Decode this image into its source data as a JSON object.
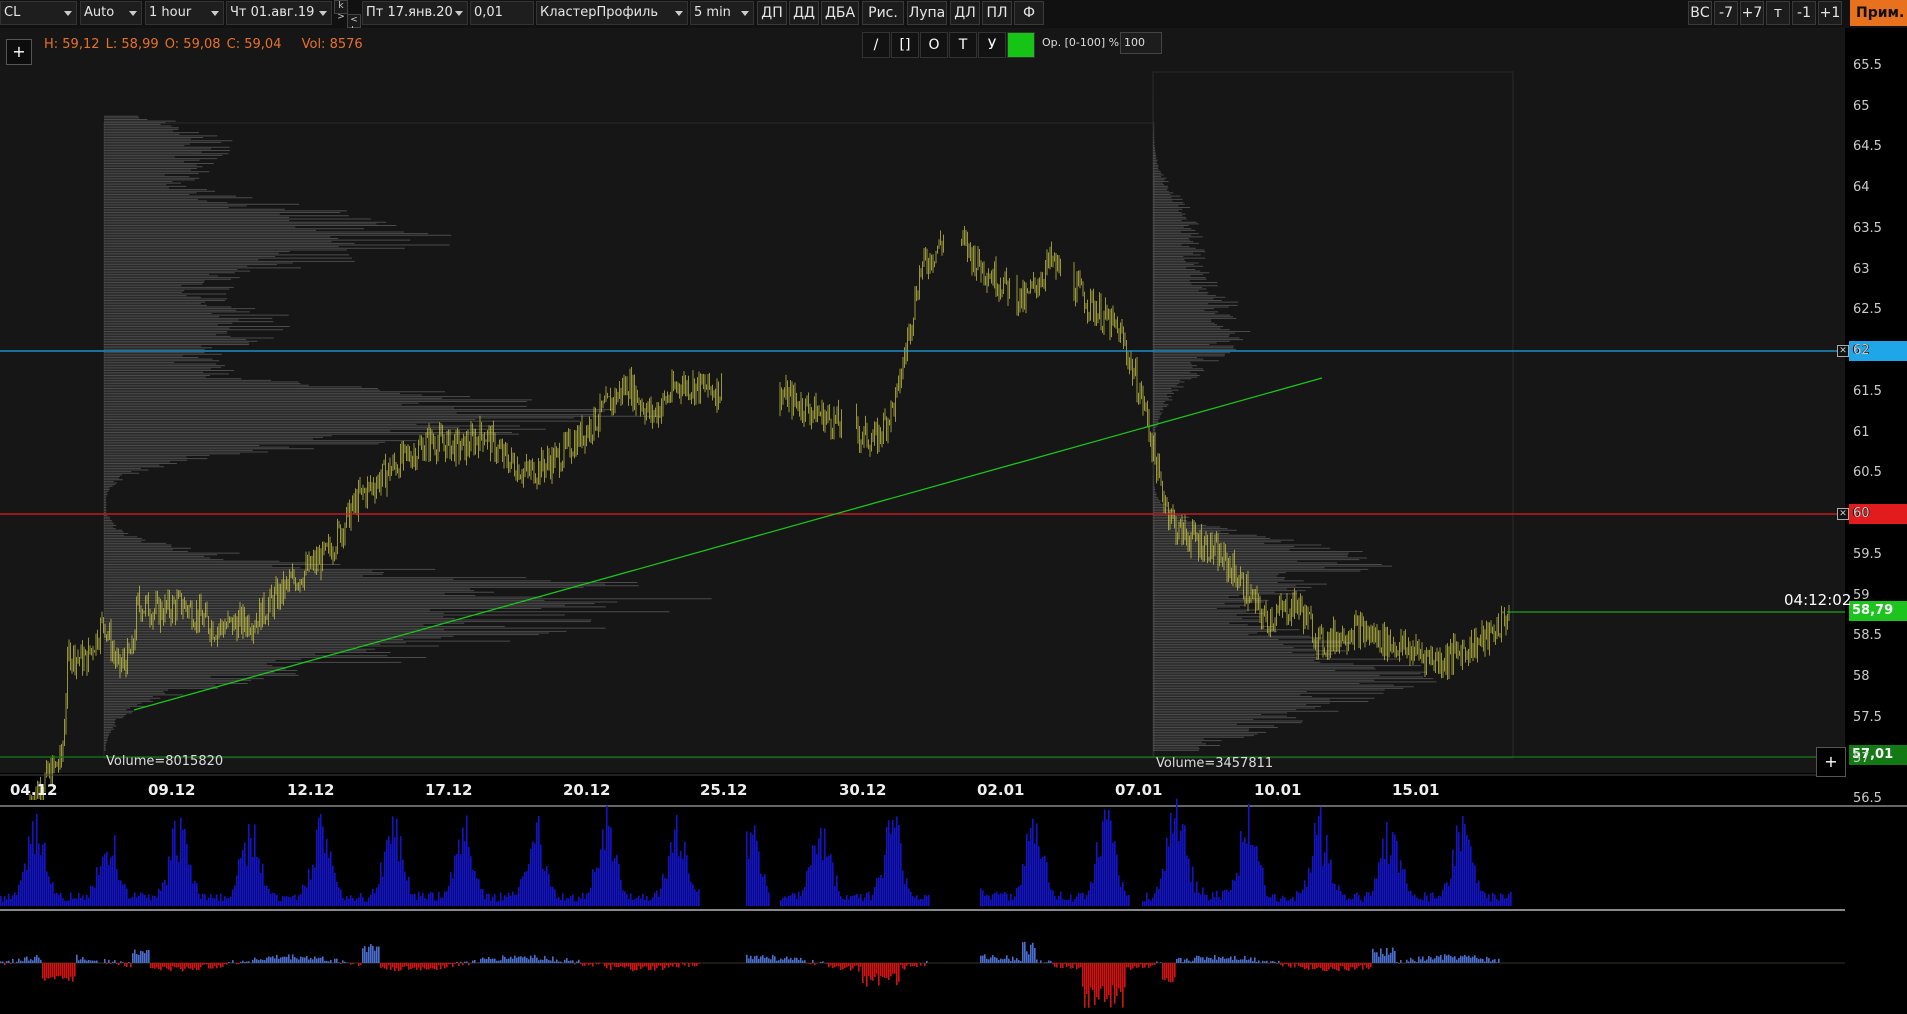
{
  "toolbar": {
    "symbol": "CL",
    "scale": "Auto",
    "timeframe": "1 hour",
    "date_from": "Чт 01.авг.19",
    "date_to": "Пт 17.янв.20",
    "step": "0,01",
    "chart_type": "КластерПрофиль",
    "cluster_tf": "5 min",
    "buttons": [
      "ДП",
      "ДД",
      "ДБА",
      "Рис.",
      "Лупа",
      "ДЛ",
      "ПЛ",
      "Ф"
    ],
    "right_buttons": [
      "ВС",
      "-7",
      "+7",
      "т",
      "-1",
      "+1"
    ],
    "prim": "Прим.",
    "k_up": "k >",
    "k_down": "< k"
  },
  "info": {
    "h": "H: 59,12",
    "l": "L: 58,99",
    "o": "O: 59,08",
    "c": "C: 59,04",
    "vol": "Vol: 8576"
  },
  "draw_tools": [
    "/",
    "[]",
    "O",
    "T",
    "У"
  ],
  "draw_color": "#16c416",
  "opacity": {
    "label": "Op. [0-100] %:",
    "value": "100"
  },
  "price_labels": [
    "65.5",
    "65",
    "64.5",
    "64",
    "63.5",
    "63",
    "62.5",
    "62",
    "61.5",
    "61",
    "60.5",
    "60",
    "59.5",
    "59",
    "58.5",
    "58",
    "57.5",
    "57",
    "56.5"
  ],
  "price_tags": [
    {
      "text": "62",
      "color": "#1ea6e8"
    },
    {
      "text": "60",
      "color": "#e21c1c"
    },
    {
      "text": "58,79",
      "color": "#1ec41e"
    },
    {
      "text": "57,01",
      "color": "#137a13"
    }
  ],
  "timer": "04:12:02",
  "date_labels": [
    "04.12",
    "09.12",
    "12.12",
    "17.12",
    "20.12",
    "25.12",
    "30.12",
    "02.01",
    "07.01",
    "10.01",
    "15.01"
  ],
  "volume_labels": [
    "Volume=8015820",
    "Volume=3457811"
  ],
  "colors": {
    "candle": "#d6d24a",
    "profile": "#777777",
    "volume": "#1414c8",
    "delta_pos": "#4a6fd0",
    "delta_neg": "#d01414",
    "trend": "#1bc41b"
  }
}
